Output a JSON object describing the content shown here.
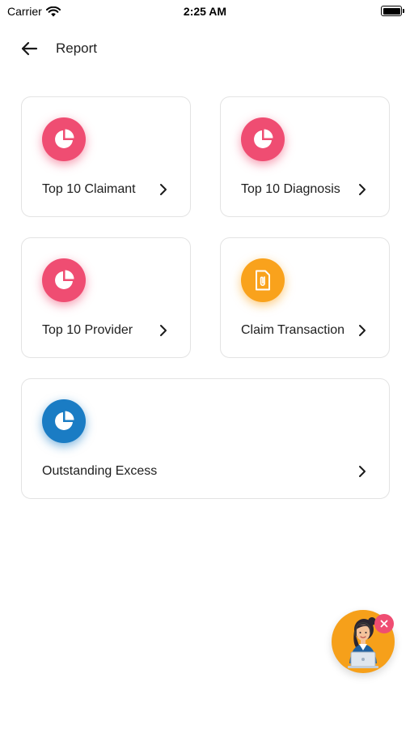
{
  "status_bar": {
    "carrier": "Carrier",
    "time": "2:25 AM",
    "icons": [
      "wifi-icon",
      "battery-icon"
    ]
  },
  "header": {
    "back_icon": "arrow-left-icon",
    "title": "Report"
  },
  "cards": [
    {
      "label": "Top 10 Claimant",
      "icon": "pie-chart-icon",
      "color": "#ef4d72"
    },
    {
      "label": "Top 10 Diagnosis",
      "icon": "pie-chart-icon",
      "color": "#ef4d72"
    },
    {
      "label": "Top 10 Provider",
      "icon": "pie-chart-icon",
      "color": "#ef4d72"
    },
    {
      "label": "Claim Transaction",
      "icon": "document-clip-icon",
      "color": "#f9a21c"
    },
    {
      "label": "Outstanding Excess",
      "icon": "pie-chart-icon",
      "color": "#1a7cc4"
    }
  ],
  "support_widget": {
    "avatar_icon": "support-agent-icon",
    "close_icon": "close-icon",
    "background": "#f6a01a"
  },
  "colors": {
    "accent_red": "#ef4d72",
    "accent_orange": "#f9a21c",
    "accent_blue": "#1a7cc4"
  }
}
